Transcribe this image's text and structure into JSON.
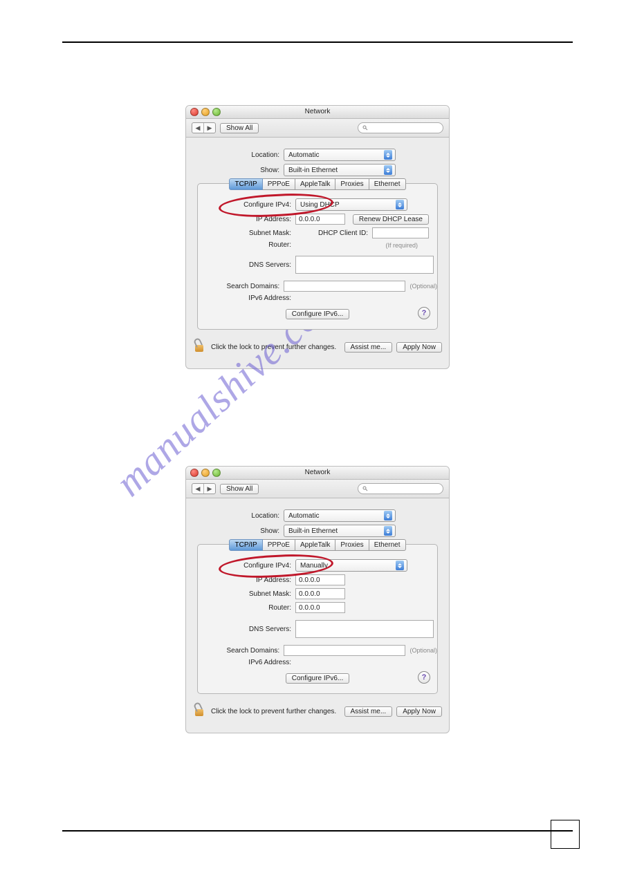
{
  "watermark": "manualshive.com",
  "panel1": {
    "title": "Network",
    "show_all": "Show All",
    "location_label": "Location:",
    "location_value": "Automatic",
    "show_label": "Show:",
    "show_value": "Built-in Ethernet",
    "tabs": [
      "TCP/IP",
      "PPPoE",
      "AppleTalk",
      "Proxies",
      "Ethernet"
    ],
    "configure_ipv4_label": "Configure IPv4:",
    "configure_ipv4_value": "Using DHCP",
    "ip_address_label": "IP Address:",
    "ip_address_value": "0.0.0.0",
    "subnet_label": "Subnet Mask:",
    "router_label": "Router:",
    "renew_btn": "Renew DHCP Lease",
    "dhcp_client_label": "DHCP Client ID:",
    "dhcp_hint": "(If required)",
    "dns_label": "DNS Servers:",
    "search_domains_label": "Search Domains:",
    "search_domains_hint": "(Optional)",
    "ipv6_addr_label": "IPv6 Address:",
    "configure_ipv6_btn": "Configure IPv6...",
    "lock_text": "Click the lock to prevent further changes.",
    "assist_btn": "Assist me...",
    "apply_btn": "Apply Now"
  },
  "panel2": {
    "title": "Network",
    "show_all": "Show All",
    "location_label": "Location:",
    "location_value": "Automatic",
    "show_label": "Show:",
    "show_value": "Built-in Ethernet",
    "tabs": [
      "TCP/IP",
      "PPPoE",
      "AppleTalk",
      "Proxies",
      "Ethernet"
    ],
    "configure_ipv4_label": "Configure IPv4:",
    "configure_ipv4_value": "Manually",
    "ip_address_label": "IP Address:",
    "ip_address_value": "0.0.0.0",
    "subnet_label": "Subnet Mask:",
    "subnet_value": "0.0.0.0",
    "router_label": "Router:",
    "router_value": "0.0.0.0",
    "dns_label": "DNS Servers:",
    "search_domains_label": "Search Domains:",
    "search_domains_hint": "(Optional)",
    "ipv6_addr_label": "IPv6 Address:",
    "configure_ipv6_btn": "Configure IPv6...",
    "lock_text": "Click the lock to prevent further changes.",
    "assist_btn": "Assist me...",
    "apply_btn": "Apply Now"
  }
}
